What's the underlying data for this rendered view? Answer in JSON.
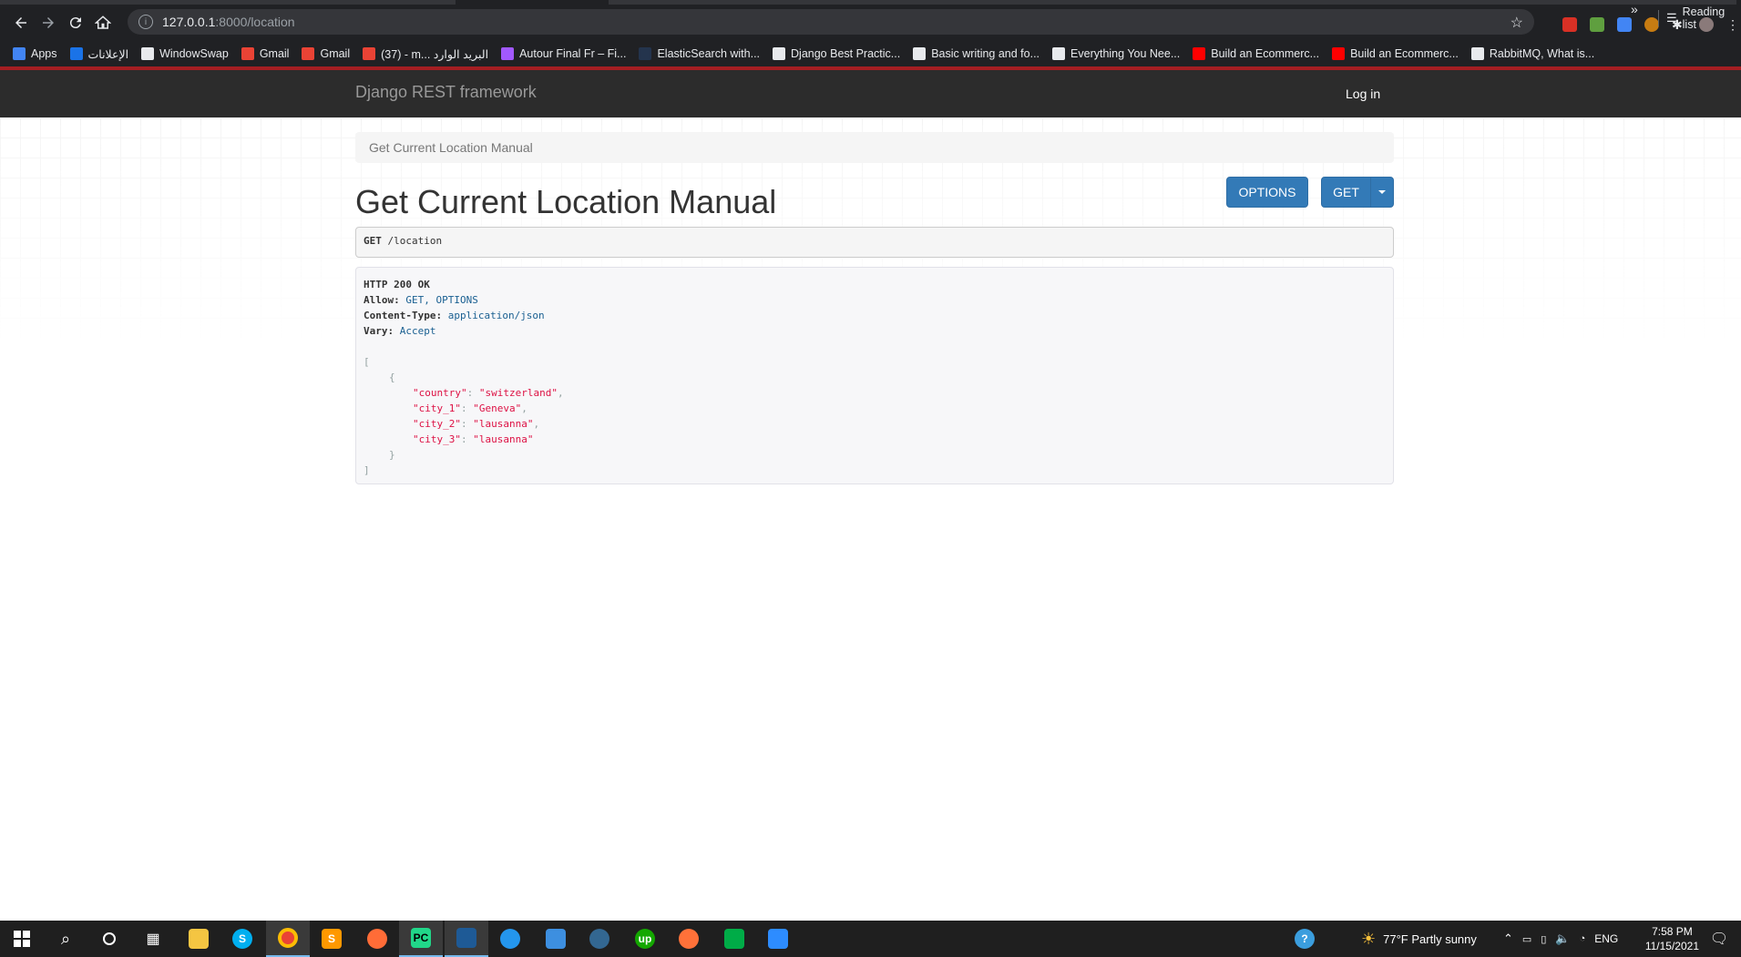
{
  "browser": {
    "url_host": "127.0.0.1",
    "url_rest": ":8000/location",
    "bookmarks": [
      {
        "label": "Apps",
        "color": "#4285f4"
      },
      {
        "label": "الإعلانات",
        "color": "#1a73e8"
      },
      {
        "label": "WindowSwap",
        "color": "#e8eaed"
      },
      {
        "label": "Gmail",
        "color": "#ea4335"
      },
      {
        "label": "Gmail",
        "color": "#ea4335"
      },
      {
        "label": "(37) - m... البريد الوارد",
        "color": "#ea4335"
      },
      {
        "label": "Autour Final Fr – Fi...",
        "color": "#a259ff"
      },
      {
        "label": "ElasticSearch with...",
        "color": "#24344d"
      },
      {
        "label": "Django Best Practic...",
        "color": "#e8eaed"
      },
      {
        "label": "Basic writing and fo...",
        "color": "#e8eaed"
      },
      {
        "label": "Everything You Nee...",
        "color": "#e8eaed"
      },
      {
        "label": "Build an Ecommerc...",
        "color": "#ff0000"
      },
      {
        "label": "Build an Ecommerc...",
        "color": "#ff0000"
      },
      {
        "label": "RabbitMQ, What is...",
        "color": "#e8eaed"
      }
    ],
    "more": "»",
    "reading_list": "Reading list"
  },
  "navbar": {
    "brand": "Django REST framework",
    "login": "Log in"
  },
  "breadcrumb": "Get Current Location Manual",
  "page_title": "Get Current Location Manual",
  "buttons": {
    "options": "OPTIONS",
    "get": "GET"
  },
  "request": {
    "method": "GET",
    "path": "/location"
  },
  "response": {
    "status": "HTTP 200 OK",
    "allow_key": "Allow:",
    "allow_val": "GET, OPTIONS",
    "ctype_key": "Content-Type:",
    "ctype_val": "application/json",
    "vary_key": "Vary:",
    "vary_val": "Accept",
    "open_bracket": "[",
    "open_brace": "{",
    "fields": [
      {
        "key": "\"country\"",
        "value": "\"switzerland\"",
        "comma": ","
      },
      {
        "key": "\"city_1\"",
        "value": "\"Geneva\"",
        "comma": ","
      },
      {
        "key": "\"city_2\"",
        "value": "\"lausanna\"",
        "comma": ","
      },
      {
        "key": "\"city_3\"",
        "value": "\"lausanna\"",
        "comma": ""
      }
    ],
    "close_brace": "}",
    "close_bracket": "]"
  },
  "taskbar": {
    "weather": "77°F  Partly sunny",
    "lang": "ENG",
    "time": "7:58 PM",
    "date": "11/15/2021"
  }
}
